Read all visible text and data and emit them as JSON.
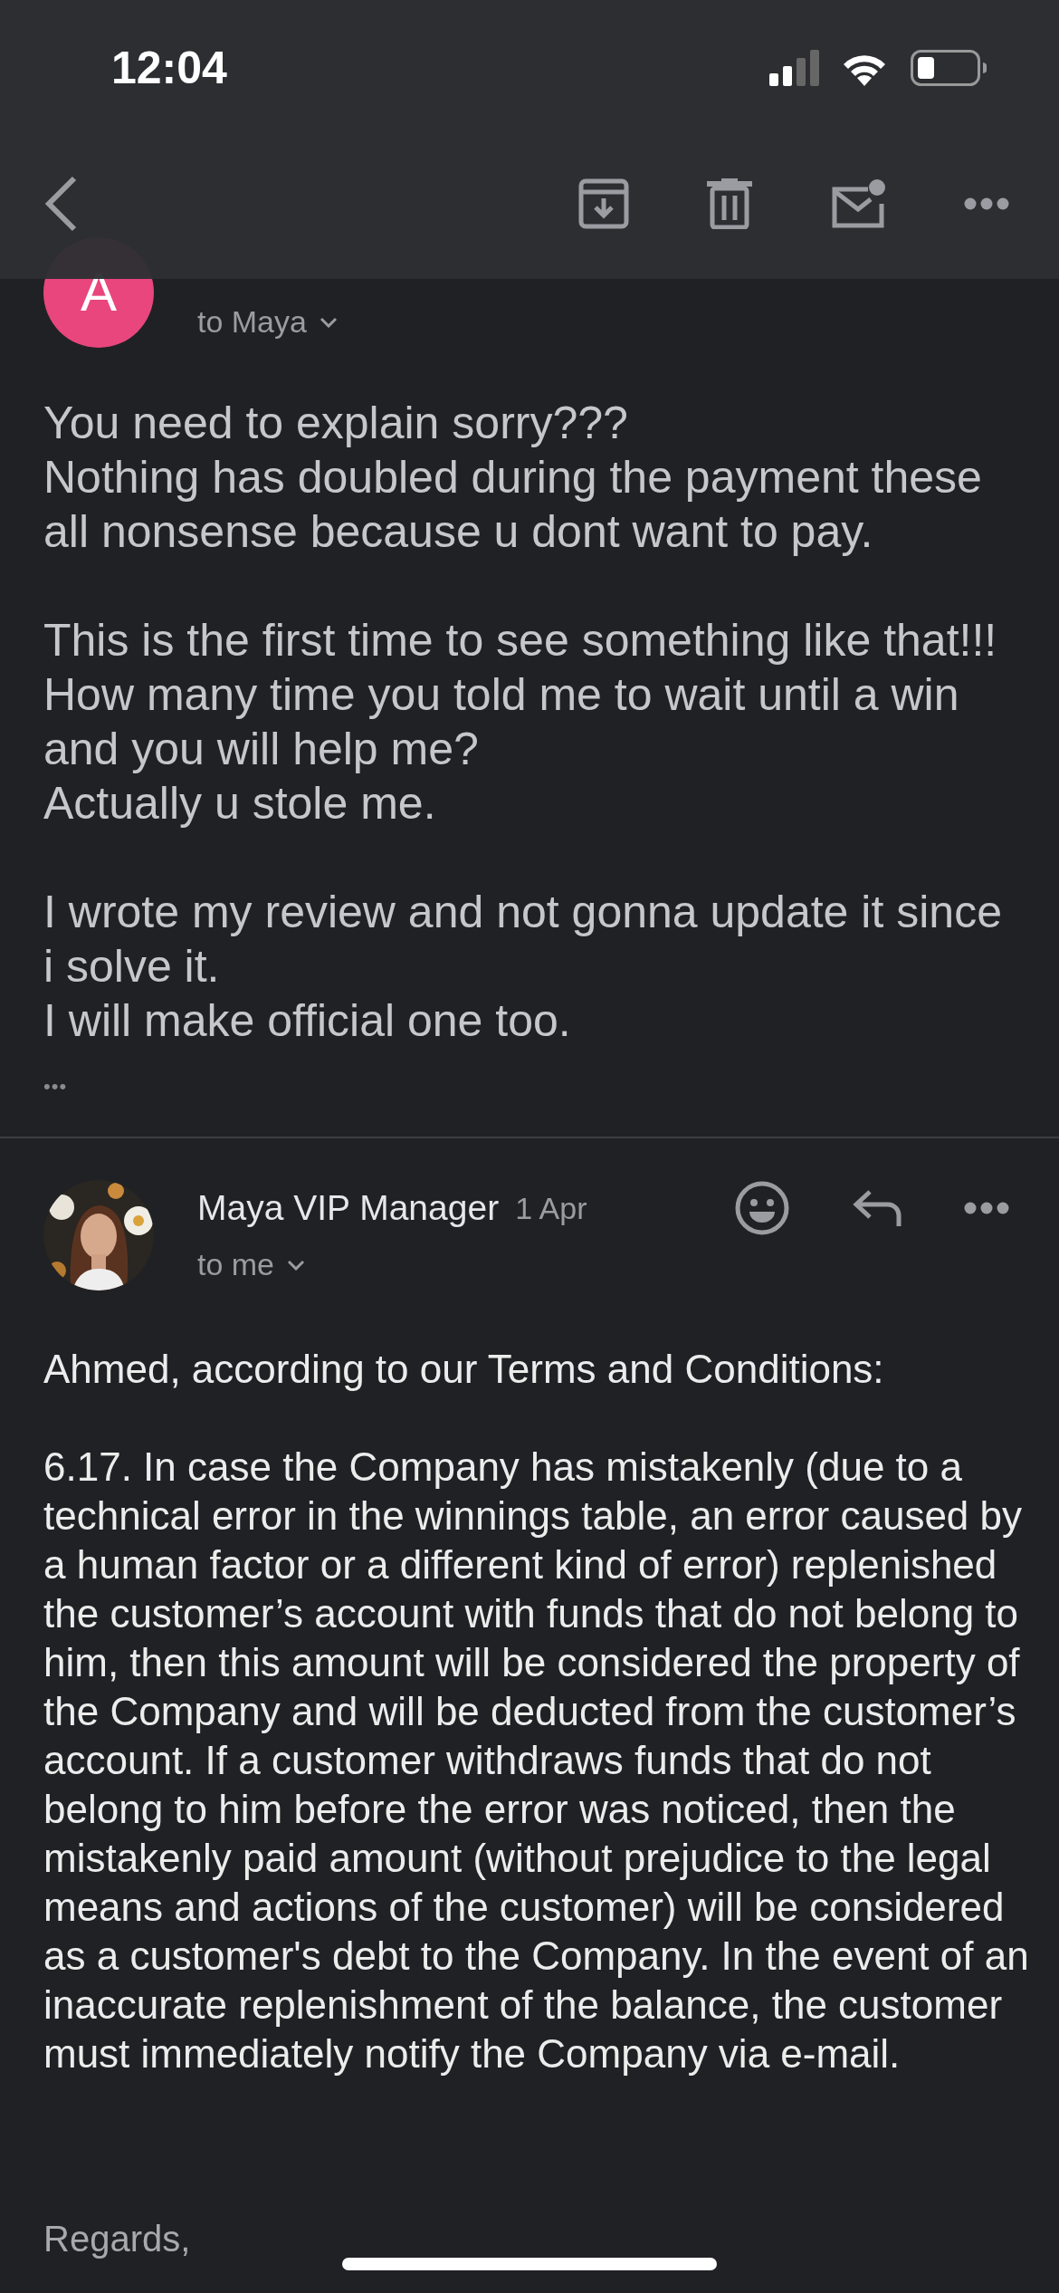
{
  "status_bar": {
    "time": "12:04"
  },
  "messages": [
    {
      "kind": "plain",
      "avatar": {
        "kind": "initial",
        "letter": "A"
      },
      "recipient": "to Maya",
      "paragraphs": [
        [
          "You need to explain sorry???",
          "Nothing has doubled during the payment these all nonsense because u dont want to pay."
        ],
        [
          "This is the first time to see something like that!!!",
          "How many time you told me to wait until a win and you will help me?",
          "Actually u stole me."
        ],
        [
          "I wrote my review and not gonna update it since i solve it.",
          "I will make official one too."
        ]
      ],
      "trimmed_content": "•••"
    },
    {
      "kind": "rich",
      "sender": "Maya VIP Manager",
      "date": "1 Apr",
      "avatar": {
        "kind": "picture"
      },
      "recipient": "to me",
      "paragraphs": [
        [
          "Ahmed, according to our Terms and Conditions:"
        ],
        [
          "6.17. In case the Company has mistakenly (due to a technical error in the winnings table, an error caused by a human factor or a different kind of error) replenished the customer’s account with funds that do not belong to him, then this amount will be considered the property of the Company and will be deducted from the customer’s account. If a customer withdraws funds that do not belong to him before the error was noticed, then the mistakenly paid amount (without prejudice to the legal means and actions of the customer) will be considered as a customer's debt to the Company. In the event of an inaccurate replenishment of the balance, the customer must immediately notify the Company via e-mail."
        ]
      ],
      "sign_off": "Regards,"
    }
  ]
}
